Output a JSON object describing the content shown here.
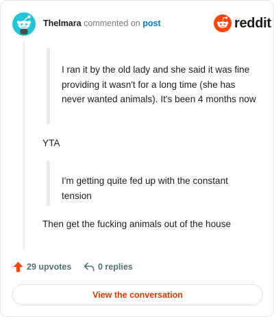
{
  "header": {
    "username": "Thelmara",
    "commented_text": "commented on",
    "post_link": "post",
    "brand": "reddit",
    "brand_color": "#ff4500",
    "avatar_icon": "snoo-avatar-icon"
  },
  "comment": {
    "quote1": "I ran it by the old lady and she said it was fine providing it wasn't for a long time (she has never wanted animals). It's been 4 months now",
    "reply1": "YTA",
    "quote2": "I'm getting quite fed up with the constant tension",
    "reply2": "Then get the fucking animals out of the house"
  },
  "footer": {
    "upvotes": "29 upvotes",
    "replies": "0 replies",
    "view_button": "View the conversation",
    "upvote_color": "#ff4500",
    "link_color": "#d93a00"
  }
}
